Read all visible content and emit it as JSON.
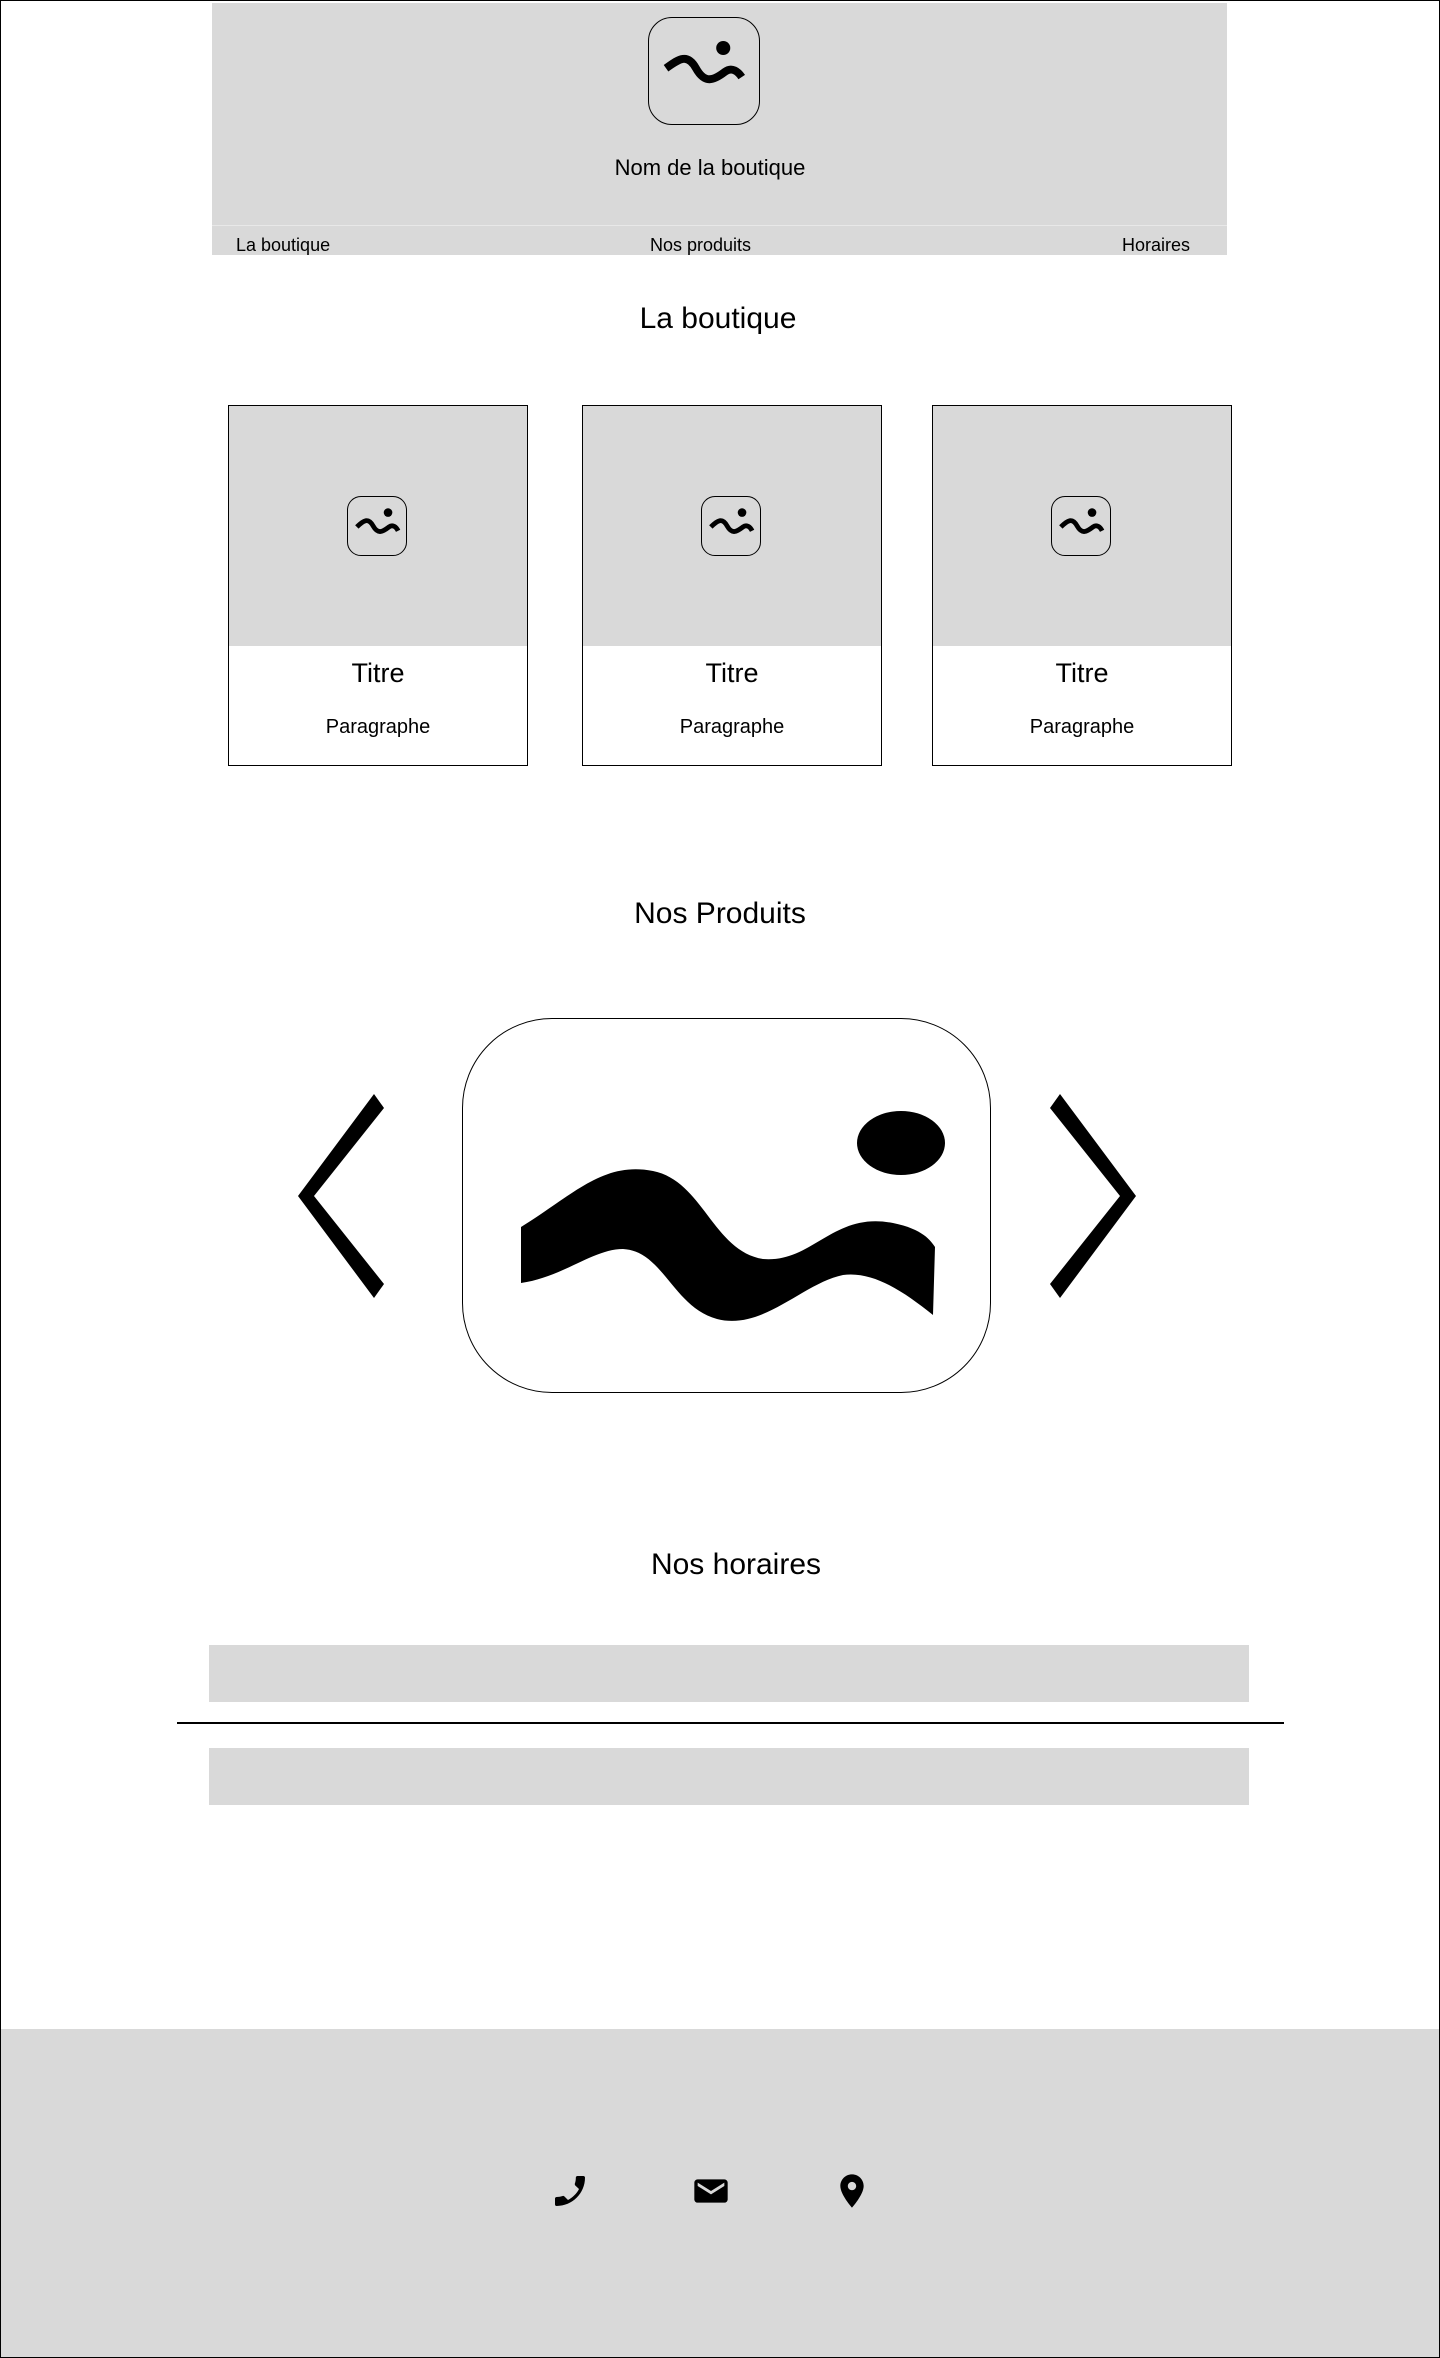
{
  "header": {
    "shop_name": "Nom de la boutique",
    "logo_icon": "image-placeholder-icon"
  },
  "nav": {
    "items": [
      {
        "label": "La boutique"
      },
      {
        "label": "Nos produits"
      },
      {
        "label": "Horaires"
      }
    ]
  },
  "boutique": {
    "title": "La boutique",
    "cards": [
      {
        "icon": "image-placeholder-icon",
        "title": "Titre",
        "text": "Paragraphe"
      },
      {
        "icon": "image-placeholder-icon",
        "title": "Titre",
        "text": "Paragraphe"
      },
      {
        "icon": "image-placeholder-icon",
        "title": "Titre",
        "text": "Paragraphe"
      }
    ]
  },
  "produits": {
    "title": "Nos Produits",
    "image_icon": "image-placeholder-icon",
    "prev_icon": "chevron-left-icon",
    "next_icon": "chevron-right-icon"
  },
  "horaires": {
    "title": "Nos horaires"
  },
  "footer": {
    "icons": [
      "phone-icon",
      "mail-icon",
      "location-pin-icon"
    ]
  },
  "colors": {
    "placeholder_gray": "#d9d9d9",
    "text": "#000000",
    "background": "#ffffff"
  }
}
